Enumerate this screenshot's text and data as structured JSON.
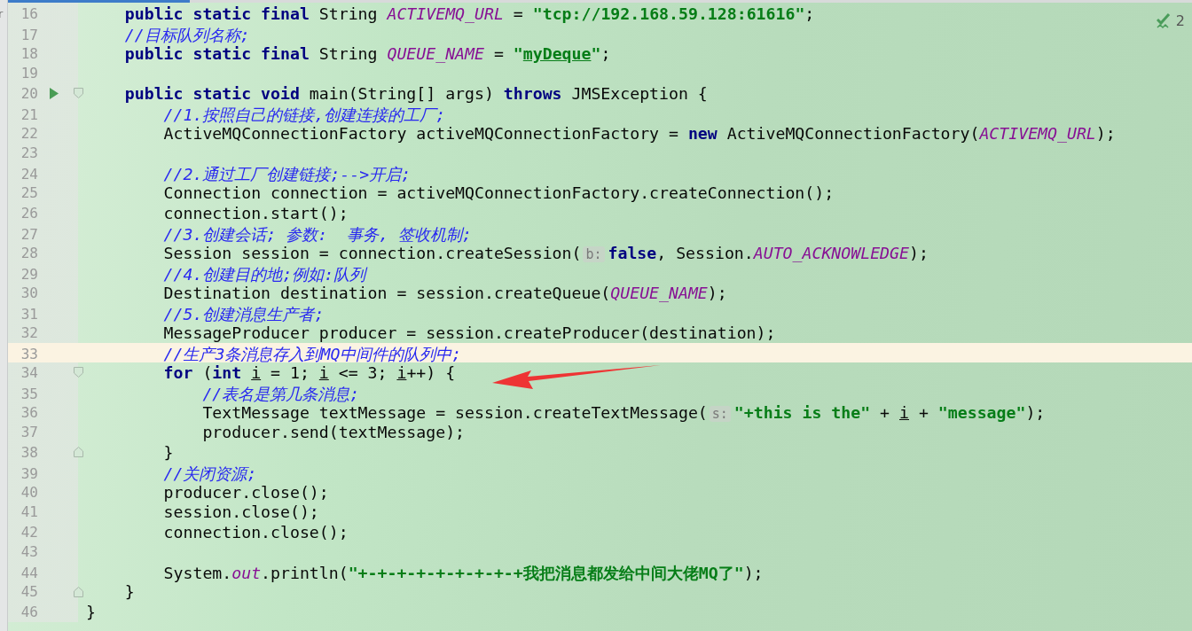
{
  "edge_fragment": "r",
  "problems": {
    "count": "2"
  },
  "lines": [
    {
      "number": "16",
      "current": false,
      "tokens": [
        {
          "kind": "kw",
          "text": "    public static final"
        },
        {
          "kind": "plain",
          "text": " String "
        },
        {
          "kind": "const",
          "text": "ACTIVEMQ_URL"
        },
        {
          "kind": "plain",
          "text": " = "
        },
        {
          "kind": "str",
          "text": "\"tcp://192.168.59.128:61616\""
        },
        {
          "kind": "plain",
          "text": ";"
        }
      ]
    },
    {
      "number": "17",
      "current": false,
      "tokens": [
        {
          "kind": "comment",
          "text": "    //目标队列名称;"
        }
      ]
    },
    {
      "number": "18",
      "current": false,
      "tokens": [
        {
          "kind": "kw",
          "text": "    public static final"
        },
        {
          "kind": "plain",
          "text": " String "
        },
        {
          "kind": "const",
          "text": "QUEUE_NAME"
        },
        {
          "kind": "plain",
          "text": " = "
        },
        {
          "kind": "str",
          "text": "\""
        },
        {
          "kind": "str_u",
          "text": "myDeque"
        },
        {
          "kind": "str",
          "text": "\""
        },
        {
          "kind": "plain",
          "text": ";"
        }
      ]
    },
    {
      "number": "19",
      "current": false
    },
    {
      "number": "20",
      "current": false,
      "gutter": [
        {
          "kind": "run"
        },
        {
          "kind": "fold-start"
        }
      ],
      "tokens": [
        {
          "kind": "kw",
          "text": "    public static void"
        },
        {
          "kind": "plain",
          "text": " main(String[] args) "
        },
        {
          "kind": "kw",
          "text": "throws"
        },
        {
          "kind": "plain",
          "text": " JMSException {"
        }
      ]
    },
    {
      "number": "21",
      "current": false,
      "tokens": [
        {
          "kind": "comment",
          "text": "        //1.按照自己的链接,创建连接的工厂;"
        }
      ]
    },
    {
      "number": "22",
      "current": false,
      "tokens": [
        {
          "kind": "plain",
          "text": "        ActiveMQConnectionFactory activeMQConnectionFactory = "
        },
        {
          "kind": "kw",
          "text": "new"
        },
        {
          "kind": "plain",
          "text": " ActiveMQConnectionFactory("
        },
        {
          "kind": "const",
          "text": "ACTIVEMQ_URL"
        },
        {
          "kind": "plain",
          "text": ");"
        }
      ]
    },
    {
      "number": "23",
      "current": false
    },
    {
      "number": "24",
      "current": false,
      "tokens": [
        {
          "kind": "comment",
          "text": "        //2.通过工厂创建链接;-->开启;"
        }
      ]
    },
    {
      "number": "25",
      "current": false,
      "tokens": [
        {
          "kind": "plain",
          "text": "        Connection connection = activeMQConnectionFactory.createConnection();"
        }
      ]
    },
    {
      "number": "26",
      "current": false,
      "tokens": [
        {
          "kind": "plain",
          "text": "        connection.start();"
        }
      ]
    },
    {
      "number": "27",
      "current": false,
      "tokens": [
        {
          "kind": "comment",
          "text": "        //3.创建会话; 参数:  事务, 签收机制;"
        }
      ]
    },
    {
      "number": "28",
      "current": false,
      "tokens": [
        {
          "kind": "plain",
          "text": "        Session session = connection.createSession("
        },
        {
          "kind": "hint",
          "text": "b:"
        },
        {
          "kind": "kw",
          "text": "false"
        },
        {
          "kind": "plain",
          "text": ", Session."
        },
        {
          "kind": "const",
          "text": "AUTO_ACKNOWLEDGE"
        },
        {
          "kind": "plain",
          "text": ");"
        }
      ]
    },
    {
      "number": "29",
      "current": false,
      "tokens": [
        {
          "kind": "comment",
          "text": "        //4.创建目的地;例如:队列"
        }
      ]
    },
    {
      "number": "30",
      "current": false,
      "tokens": [
        {
          "kind": "plain",
          "text": "        Destination destination = session.createQueue("
        },
        {
          "kind": "const",
          "text": "QUEUE_NAME"
        },
        {
          "kind": "plain",
          "text": ");"
        }
      ]
    },
    {
      "number": "31",
      "current": false,
      "tokens": [
        {
          "kind": "comment",
          "text": "        //5.创建消息生产者;"
        }
      ]
    },
    {
      "number": "32",
      "current": false,
      "tokens": [
        {
          "kind": "plain",
          "text": "        MessageProducer producer = session.createProducer(destination);"
        }
      ]
    },
    {
      "number": "33",
      "current": true,
      "tokens": [
        {
          "kind": "comment",
          "text": "        //生产3条消息存入到MQ中间件的队列中;"
        }
      ]
    },
    {
      "number": "34",
      "current": false,
      "gutter": [
        {
          "kind": "fold-start"
        }
      ],
      "tokens": [
        {
          "kind": "kw",
          "text": "        for"
        },
        {
          "kind": "plain",
          "text": " ("
        },
        {
          "kind": "kw",
          "text": "int "
        },
        {
          "kind": "var",
          "text": "i"
        },
        {
          "kind": "plain",
          "text": " = 1; "
        },
        {
          "kind": "var",
          "text": "i"
        },
        {
          "kind": "plain",
          "text": " <= 3; "
        },
        {
          "kind": "var",
          "text": "i"
        },
        {
          "kind": "plain",
          "text": "++) {"
        }
      ]
    },
    {
      "number": "35",
      "current": false,
      "tokens": [
        {
          "kind": "comment",
          "text": "            //表名是第几条消息;"
        }
      ]
    },
    {
      "number": "36",
      "current": false,
      "tokens": [
        {
          "kind": "plain",
          "text": "            TextMessage textMessage = session.createTextMessage("
        },
        {
          "kind": "hint",
          "text": "s:"
        },
        {
          "kind": "str",
          "text": "\"+this is the\""
        },
        {
          "kind": "plain",
          "text": " + "
        },
        {
          "kind": "var",
          "text": "i"
        },
        {
          "kind": "plain",
          "text": " + "
        },
        {
          "kind": "str",
          "text": "\"message\""
        },
        {
          "kind": "plain",
          "text": ");"
        }
      ]
    },
    {
      "number": "37",
      "current": false,
      "tokens": [
        {
          "kind": "plain",
          "text": "            producer.send(textMessage);"
        }
      ]
    },
    {
      "number": "38",
      "current": false,
      "gutter": [
        {
          "kind": "fold-end"
        }
      ],
      "tokens": [
        {
          "kind": "plain",
          "text": "        }"
        }
      ]
    },
    {
      "number": "39",
      "current": false,
      "tokens": [
        {
          "kind": "comment",
          "text": "        //关闭资源;"
        }
      ]
    },
    {
      "number": "40",
      "current": false,
      "tokens": [
        {
          "kind": "plain",
          "text": "        producer.close();"
        }
      ]
    },
    {
      "number": "41",
      "current": false,
      "tokens": [
        {
          "kind": "plain",
          "text": "        session.close();"
        }
      ]
    },
    {
      "number": "42",
      "current": false,
      "tokens": [
        {
          "kind": "plain",
          "text": "        connection.close();"
        }
      ]
    },
    {
      "number": "43",
      "current": false
    },
    {
      "number": "44",
      "current": false,
      "tokens": [
        {
          "kind": "plain",
          "text": "        System."
        },
        {
          "kind": "const",
          "text": "out"
        },
        {
          "kind": "plain",
          "text": ".println("
        },
        {
          "kind": "str",
          "text": "\"+-+-+-+-+-+-+-+-+我把消息都发给中间大佬MQ了\""
        },
        {
          "kind": "plain",
          "text": ");"
        }
      ]
    },
    {
      "number": "45",
      "current": false,
      "gutter": [
        {
          "kind": "fold-end"
        }
      ],
      "tokens": [
        {
          "kind": "plain",
          "text": "    }"
        }
      ]
    },
    {
      "number": "46",
      "current": false,
      "tokens": [
        {
          "kind": "plain",
          "text": "}"
        }
      ]
    }
  ]
}
